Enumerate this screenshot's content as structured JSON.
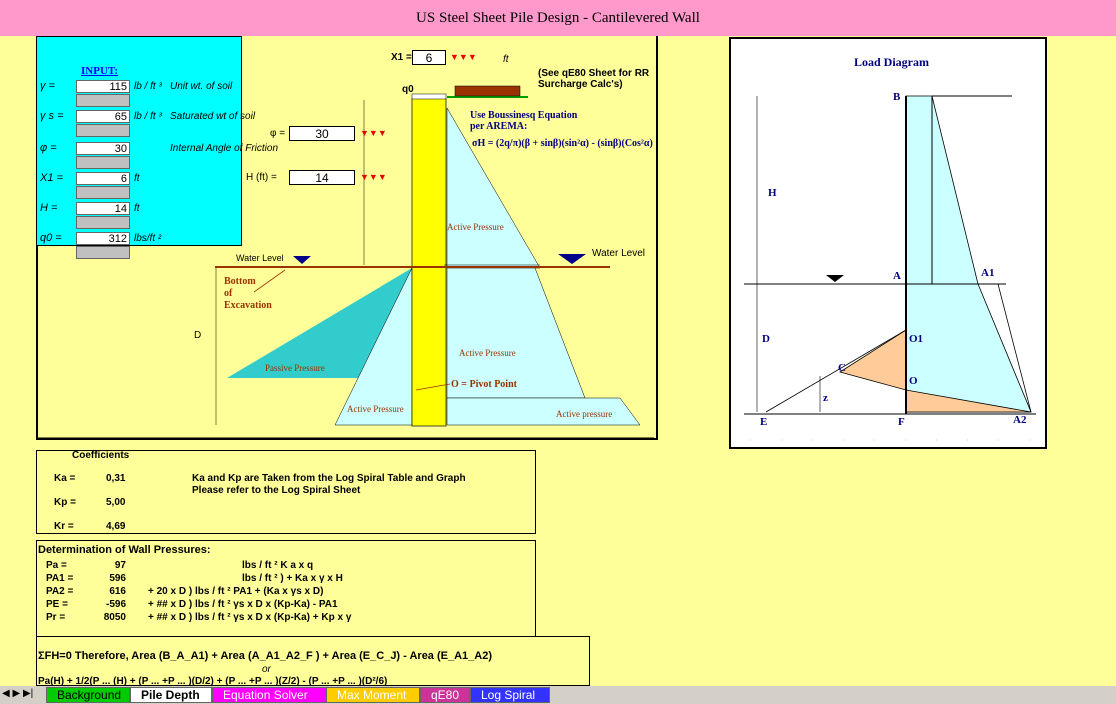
{
  "title": "US Steel Sheet Pile Design - Cantilevered Wall",
  "input": {
    "heading": "INPUT:",
    "rows": [
      {
        "sym": "γ =",
        "value": "115",
        "unit": "lb / ft ³",
        "desc": "Unit wt. of soil"
      },
      {
        "sym": "γ s =",
        "value": "65",
        "unit": "lb / ft ³",
        "desc": "Saturated wt of soil"
      },
      {
        "sym": "φ =",
        "value": "30",
        "unit": "",
        "desc": "Internal Angle of Friction"
      },
      {
        "sym": "X1 =",
        "value": "6",
        "unit": "ft",
        "desc": ""
      },
      {
        "sym": "H =",
        "value": "14",
        "unit": "ft",
        "desc": ""
      },
      {
        "sym": "q0 =",
        "value": "312",
        "unit": "lbs/ft ²",
        "desc": ""
      }
    ]
  },
  "diagram": {
    "x1_label": "X1 =",
    "x1_value": "6",
    "x1_unit": "ft",
    "arrows": "▼▼▼",
    "phi_label": "φ =",
    "phi_value": "30",
    "h_label": "H (ft) =",
    "h_value": "14",
    "see_note": "(See qE80 Sheet for RR Surcharge Calc's)",
    "boussinesq": "Use Boussinesq Equation per AREMA:",
    "equation": "σH = (2q/π)(β + sinβ)(sin²α) - (sinβ)(Cos²α)",
    "q0": "q0",
    "active1": "Active Pressure",
    "active2": "Active Pressure",
    "active3": "Active Pressure",
    "active4": "Active pressure",
    "passive": "Passive Pressure",
    "water_left": "Water Level",
    "water_right": "Water Level",
    "bottom": [
      "Bottom",
      "of",
      "Excavation"
    ],
    "d": "D",
    "pivot": "O = Pivot Point"
  },
  "load": {
    "title": "Load Diagram",
    "labels": {
      "B": "B",
      "H": "H",
      "A": "A",
      "A1": "A1",
      "D": "D",
      "O1": "O1",
      "C": "C",
      "O": "O",
      "z": "z",
      "E": "E",
      "F": "F",
      "A2": "A2"
    }
  },
  "coefficients": {
    "heading": "Coefficients",
    "rows": [
      {
        "sym": "Ka =",
        "value": "0,31"
      },
      {
        "sym": "Kp =",
        "value": "5,00"
      },
      {
        "sym": "Kr =",
        "value": "4,69"
      }
    ],
    "note1": "Ka and Kp are Taken from the Log Spiral Table and Graph",
    "note2": "Please refer to the Log Spiral Sheet"
  },
  "pressures": {
    "heading": "Determination of Wall Pressures:",
    "rows": [
      {
        "sym": "Pa =",
        "value": "97",
        "mid": "",
        "formula": "lbs / ft ²      K a x q"
      },
      {
        "sym": "PA1 =",
        "value": "596",
        "mid": "",
        "formula": "lbs / ft ² ) + Ka x γ x H"
      },
      {
        "sym": "PA2 =",
        "value": "616",
        "mid": "+      20  x D ) lbs / ft ²  PA1 + (Ka x γs x D)",
        "formula": ""
      },
      {
        "sym": "PE =",
        "value": "-596",
        "mid": "+      ## x D ) lbs / ft ²  γs x D x (Kp-Ka) - PA1",
        "formula": ""
      },
      {
        "sym": "Pr =",
        "value": "8050",
        "mid": "+      ## x D ) lbs / ft ²  γs x D x (Kp-Ka) + Kp x γ",
        "formula": ""
      }
    ]
  },
  "sum": {
    "line1": "ΣFH=0  Therefore, Area (B_A_A1) + Area (A_A1_A2_F ) + Area (E_C_J) - Area (E_A1_A2)",
    "or": "or",
    "line2": "Pa(H) + 1/2(P ... (H) + (P ... +P ... )(D/2) + (P ... +P ... )(Z/2) - (P ... +P ... )(D²/6)"
  },
  "tabs": [
    "Background",
    "Pile Depth",
    "Equation Solver",
    "Max Moment",
    "qE80",
    "Log Spiral"
  ],
  "colors": {
    "bg": "#ff99cc",
    "sheet": "#ffff99",
    "cyan": "#00ffff",
    "pile": "#ffff00",
    "peach": "#ffcc99",
    "lightcyan": "#ccffff",
    "teal": "#33cccc"
  }
}
